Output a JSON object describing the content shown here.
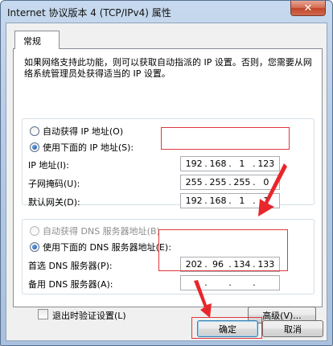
{
  "window": {
    "title": "Internet 协议版本 4 (TCP/IPv4) 属性",
    "close_glyph": "✕"
  },
  "tab": {
    "label": "常规"
  },
  "description": "如果网络支持此功能，则可以获取自动指派的 IP 设置。否则，您需要从网络系统管理员处获得适当的 IP 设置。",
  "ip_section": {
    "auto_label": "自动获得 IP 地址(O)",
    "manual_label": "使用下面的 IP 地址(S):",
    "auto_checked": false,
    "manual_checked": true,
    "ip_label": "IP 地址(I):",
    "ip_value": [
      "192",
      "168",
      "1",
      "123"
    ],
    "mask_label": "子网掩码(U):",
    "mask_value": [
      "255",
      "255",
      "255",
      "0"
    ],
    "gateway_label": "默认网关(D):",
    "gateway_value": [
      "192",
      "168",
      "1",
      "1"
    ]
  },
  "dns_section": {
    "auto_label": "自动获得 DNS 服务器地址(B)",
    "manual_label": "使用下面的 DNS 服务器地址(E):",
    "auto_checked": false,
    "manual_checked": true,
    "preferred_label": "首选 DNS 服务器(P):",
    "preferred_value": [
      "202",
      "96",
      "134",
      "133"
    ],
    "alternate_label": "备用 DNS 服务器(A):",
    "alternate_value": [
      "",
      "",
      "",
      ""
    ]
  },
  "validate_label": "退出时验证设置(L)",
  "advanced_button": "高级(V)...",
  "ok_button": "确定",
  "cancel_button": "取消",
  "colors": {
    "highlight": "#e0383c",
    "arrow": "#e8262b",
    "accent": "#1c4c9a"
  }
}
